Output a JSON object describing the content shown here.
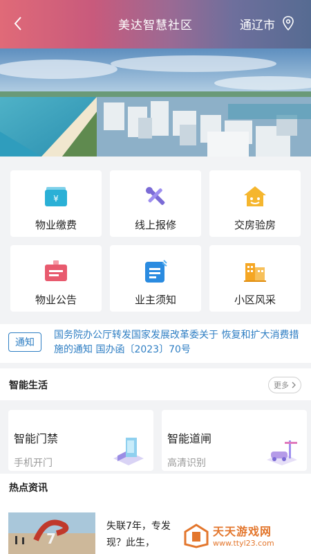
{
  "header": {
    "title": "美达智慧社区",
    "city": "通辽市"
  },
  "services": [
    {
      "label": "物业缴费",
      "icon": "wallet-yen-icon",
      "color": "#2ab0d6"
    },
    {
      "label": "线上报修",
      "icon": "repair-tools-icon",
      "color": "#7b6bd6"
    },
    {
      "label": "交房验房",
      "icon": "house-key-icon",
      "color": "#f5b62e"
    },
    {
      "label": "物业公告",
      "icon": "announcement-board-icon",
      "color": "#e85a6e"
    },
    {
      "label": "业主须知",
      "icon": "notice-doc-icon",
      "color": "#2a8be0"
    },
    {
      "label": "小区风采",
      "icon": "buildings-icon",
      "color": "#f5a623"
    }
  ],
  "notice": {
    "tag": "通知",
    "text": "国务院办公厅转发国家发展改革委关于 恢复和扩大消费措施的通知  国办函〔2023〕70号"
  },
  "smart_life": {
    "title": "智能生活",
    "more": "更多",
    "cards": [
      {
        "title": "智能门禁",
        "subtitle": "手机开门"
      },
      {
        "title": "智能道闸",
        "subtitle": "高清识别"
      }
    ]
  },
  "hot_news": {
    "title": "热点资讯",
    "items": [
      {
        "text": "失联7年，专发现？此生，"
      }
    ]
  },
  "watermark": {
    "title": "天天游戏网",
    "url": "www.ttyl23.com"
  }
}
